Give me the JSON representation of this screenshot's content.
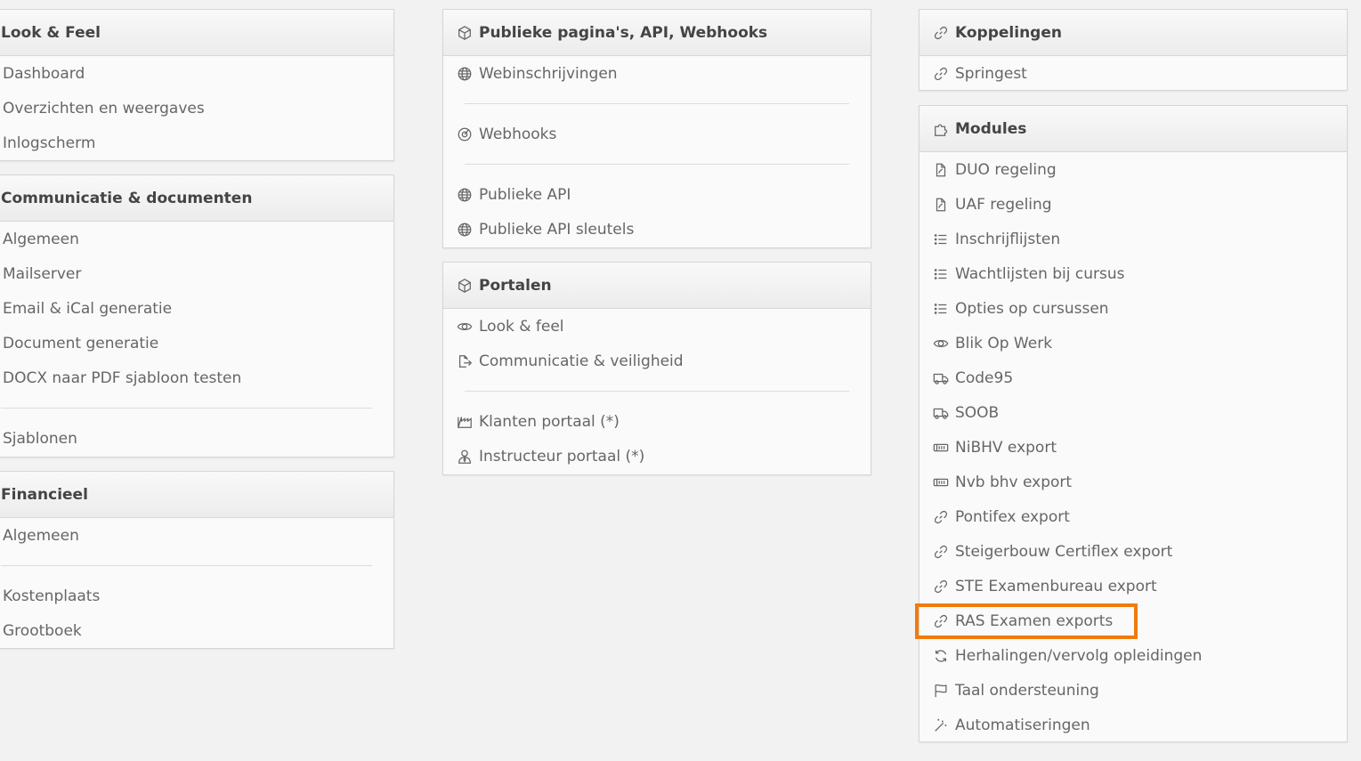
{
  "colors": {
    "highlight": "#f07b0e"
  },
  "col1": {
    "look_feel": {
      "title": "Look & Feel",
      "items": [
        "Dashboard",
        "Overzichten en weergaves",
        "Inlogscherm"
      ]
    },
    "communicatie": {
      "title": "Communicatie & documenten",
      "items": [
        "Algemeen",
        "Mailserver",
        "Email & iCal generatie",
        "Document generatie",
        "DOCX naar PDF sjabloon testen",
        "Sjablonen"
      ]
    },
    "financieel": {
      "title": "Financieel",
      "items": [
        "Algemeen",
        "Kostenplaats",
        "Grootboek"
      ]
    }
  },
  "col2": {
    "publiek": {
      "title": "Publieke pagina's, API, Webhooks",
      "items": [
        {
          "label": "Webinschrijvingen",
          "icon": "globe-icon"
        },
        {
          "label": "Webhooks",
          "icon": "webhook-icon"
        },
        {
          "label": "Publieke API",
          "icon": "globe-icon"
        },
        {
          "label": "Publieke API sleutels",
          "icon": "globe-icon"
        }
      ]
    },
    "portalen": {
      "title": "Portalen",
      "items": [
        {
          "label": "Look & feel",
          "icon": "eye-icon"
        },
        {
          "label": "Communicatie & veiligheid",
          "icon": "file-export-icon"
        },
        {
          "label": "Klanten portaal (*)",
          "icon": "building-icon"
        },
        {
          "label": "Instructeur portaal (*)",
          "icon": "user-tie-icon"
        }
      ]
    }
  },
  "col3": {
    "koppelingen": {
      "title": "Koppelingen",
      "items": [
        {
          "label": "Springest",
          "icon": "link-icon"
        }
      ]
    },
    "modules": {
      "title": "Modules",
      "items": [
        {
          "label": "DUO regeling",
          "icon": "file-icon"
        },
        {
          "label": "UAF regeling",
          "icon": "file-icon"
        },
        {
          "label": "Inschrijflijsten",
          "icon": "list-icon"
        },
        {
          "label": "Wachtlijsten bij cursus",
          "icon": "list-icon"
        },
        {
          "label": "Opties op cursussen",
          "icon": "list-icon"
        },
        {
          "label": "Blik Op Werk",
          "icon": "eye-icon"
        },
        {
          "label": "Code95",
          "icon": "truck-icon"
        },
        {
          "label": "SOOB",
          "icon": "truck-icon"
        },
        {
          "label": "NiBHV export",
          "icon": "ticket-icon"
        },
        {
          "label": "Nvb bhv export",
          "icon": "ticket-icon"
        },
        {
          "label": "Pontifex export",
          "icon": "link-icon"
        },
        {
          "label": "Steigerbouw Certiflex export",
          "icon": "link-icon"
        },
        {
          "label": "STE Examenbureau export",
          "icon": "link-icon"
        },
        {
          "label": "RAS Examen exports",
          "icon": "link-icon"
        },
        {
          "label": "Herhalingen/vervolg opleidingen",
          "icon": "sync-icon"
        },
        {
          "label": "Taal ondersteuning",
          "icon": "flag-icon"
        },
        {
          "label": "Automatiseringen",
          "icon": "magic-wand-icon"
        }
      ]
    }
  }
}
